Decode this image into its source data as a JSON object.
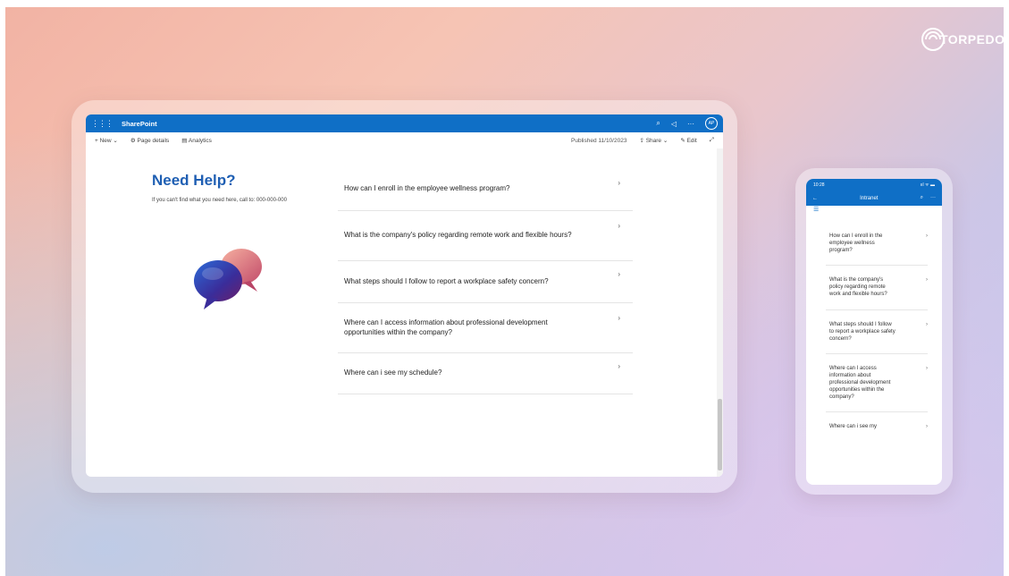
{
  "brand": {
    "name": "TORPEDO"
  },
  "sharepoint": {
    "app_title": "SharePoint",
    "avatar_initials": "AP",
    "more_label": "···",
    "commands": {
      "new_label": "+ New",
      "page_details_label": "Page details",
      "analytics_label": "Analytics",
      "published_text": "Published 11/10/2023",
      "share_label": "Share",
      "edit_label": "Edit"
    }
  },
  "page": {
    "heading": "Need Help?",
    "subtext": "If you can't find what you need here, call to: 000-000-000"
  },
  "faq": [
    {
      "question": "How can I enroll in the employee wellness program?"
    },
    {
      "question": "What is the company's policy regarding remote work and flexible hours?"
    },
    {
      "question": "What steps should I follow to report a workplace safety concern?"
    },
    {
      "question": "Where can I access information about professional development opportunities within the company?"
    },
    {
      "question": "Where can i see my schedule?"
    }
  ],
  "phone": {
    "time": "10:28",
    "status_icons": "ııl ᯤ ▬",
    "nav_title": "Intranet",
    "back_label": "←",
    "menu_label": "☰",
    "items": [
      {
        "question": "How can I enroll in the employee wellness program?"
      },
      {
        "question": "What is the company's policy regarding remote work and flexible hours?"
      },
      {
        "question": "What steps should I follow to report a workplace safety concern?"
      },
      {
        "question": "Where can I access information about professional development opportunities within the company?"
      },
      {
        "question": "Where can i see my"
      }
    ]
  },
  "colors": {
    "sharepoint_blue": "#0f6fc6",
    "heading_blue": "#1f5fb3"
  }
}
